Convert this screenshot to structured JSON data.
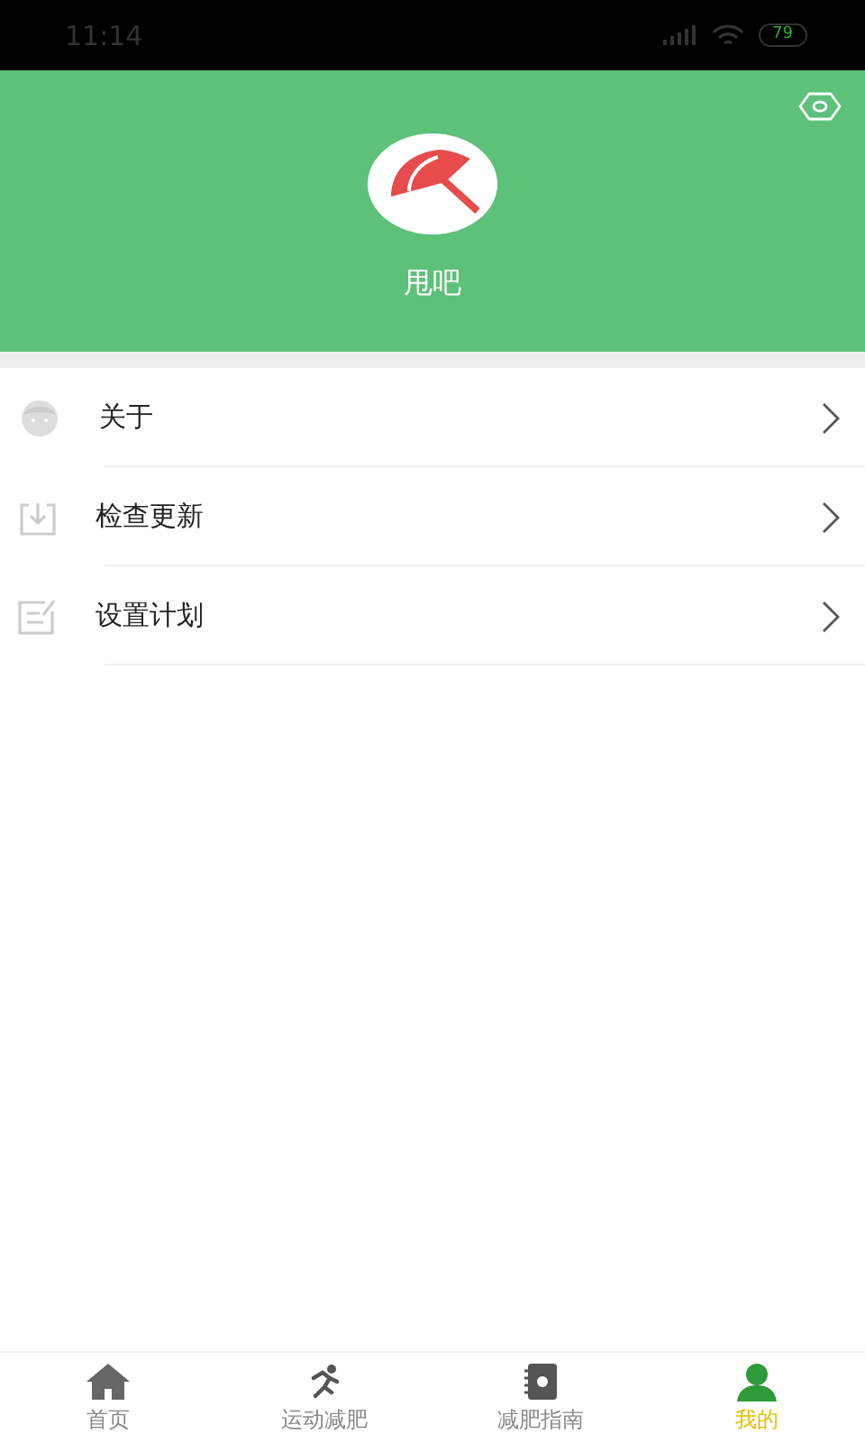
{
  "status_bar": {
    "time": "11:14",
    "battery": "79"
  },
  "header": {
    "app_name": "甩吧"
  },
  "menu": [
    {
      "kind": "person",
      "label": "关于"
    },
    {
      "kind": "download",
      "label": "检查更新"
    },
    {
      "kind": "edit",
      "label": "设置计划"
    }
  ],
  "tabs": [
    {
      "kind": "home",
      "label": "首页",
      "selected": false
    },
    {
      "kind": "run",
      "label": "运动减肥",
      "selected": false
    },
    {
      "kind": "book",
      "label": "减肥指南",
      "selected": false
    },
    {
      "kind": "user",
      "label": "我的",
      "selected": true
    }
  ]
}
